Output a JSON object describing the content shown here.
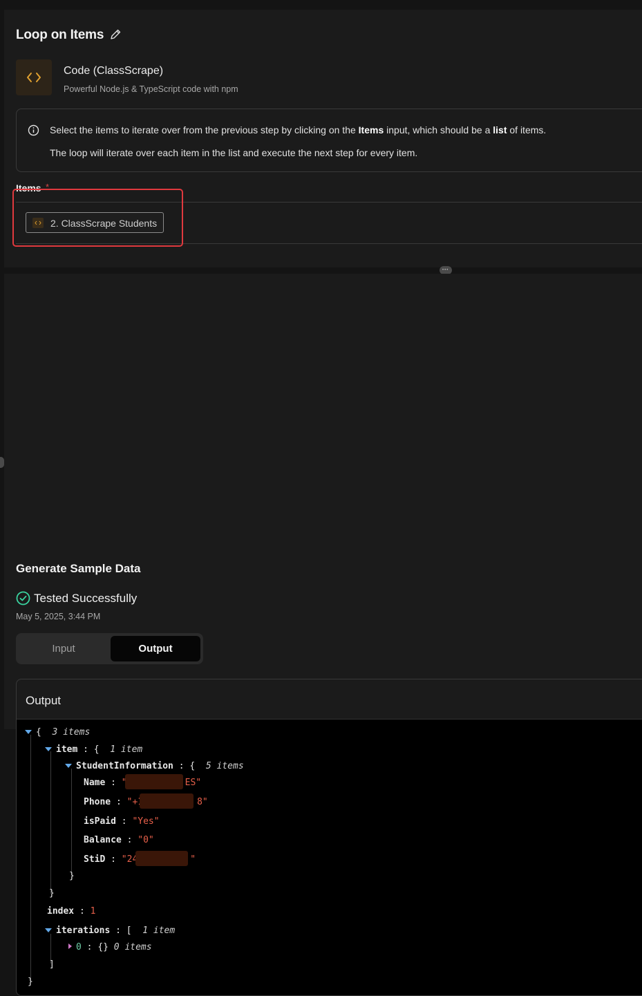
{
  "step": {
    "title": "Loop on Items",
    "app_name": "Code (ClassScrape)",
    "app_description": "Powerful Node.js & TypeScript code with npm"
  },
  "info": {
    "line1_before": "Select the items to iterate over from the previous step by clicking on the ",
    "line1_items": "Items",
    "line1_middle": " input, which should be a ",
    "line1_list": "list",
    "line1_after": " of items.",
    "line2": "The loop will iterate over each item in the list and execute the next step for every item."
  },
  "items_field": {
    "label": "Items",
    "required_mark": "*",
    "chip_label": "2. ClassScrape Students"
  },
  "sample": {
    "title": "Generate Sample Data",
    "status": "Tested Successfully",
    "timestamp": "May 5, 2025, 3:44 PM",
    "tabs": [
      "Input",
      "Output"
    ],
    "active_tab": "Output"
  },
  "output": {
    "header": "Output",
    "json": {
      "root_open": "{",
      "root_count": "3 items",
      "item_key": "item",
      "item_count": "1 item",
      "student_key": "StudentInformation",
      "student_count": "5 items",
      "fields": [
        {
          "key": "Name",
          "value_start": "\"",
          "value_end": "ES\""
        },
        {
          "key": "Phone",
          "value_start": "\"+1",
          "value_end": "8\""
        },
        {
          "key": "isPaid",
          "value_start": "\"Yes\"",
          "value_end": ""
        },
        {
          "key": "Balance",
          "value_start": "\"0\"",
          "value_end": ""
        },
        {
          "key": "StiD",
          "value_start": "\"24",
          "value_end": "\""
        }
      ],
      "close_brace": "}",
      "index_key": "index",
      "index_value": "1",
      "iterations_key": "iterations",
      "iterations_count": "1 item",
      "iter0_key": "0",
      "iter0_value": "{}",
      "iter0_count": "0 items",
      "close_bracket": "]"
    }
  },
  "colors": {
    "accent_orange": "#e0a030",
    "success_green": "#3ad4a0",
    "highlight_red": "#e0393e",
    "string_red": "#e8604a"
  },
  "icons": [
    "pencil-icon",
    "code-icon",
    "info-icon",
    "check-circle-icon",
    "drag-handle-icon",
    "caret-down-icon",
    "caret-right-icon"
  ]
}
